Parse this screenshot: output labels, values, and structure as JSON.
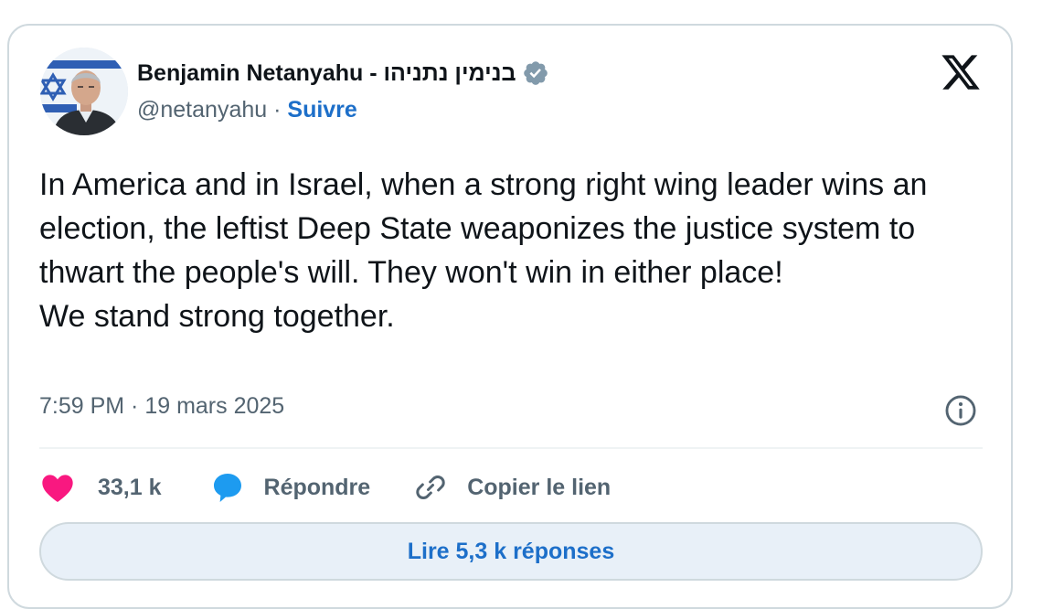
{
  "tweet": {
    "author_name": "Benjamin Netanyahu - בנימין נתניהו",
    "handle": "@netanyahu",
    "separator": "·",
    "follow_label": "Suivre",
    "text_lines": [
      "In America and in Israel, when a strong right wing leader wins an election, the leftist Deep State weaponizes the justice system to thwart the people's will. They won't win in either place!",
      "We stand strong together."
    ],
    "timestamp": "7:59 PM · 19 mars 2025"
  },
  "actions": {
    "likes_count": "33,1 k",
    "reply_label": "Répondre",
    "copy_link_label": "Copier le lien"
  },
  "read_replies_label": "Lire 5,3 k réponses",
  "icons": {
    "logo": "x-logo-icon",
    "verified": "verified-badge-icon",
    "info": "info-icon",
    "like": "heart-icon",
    "reply": "speech-bubble-icon",
    "copy": "link-icon"
  },
  "colors": {
    "like": "#f91880",
    "reply": "#1d9bf0",
    "link_blue": "#1d6fc9",
    "muted": "#536471",
    "verified": "#829aab",
    "border": "#cfd9de",
    "button_bg": "#e8f0f8"
  }
}
